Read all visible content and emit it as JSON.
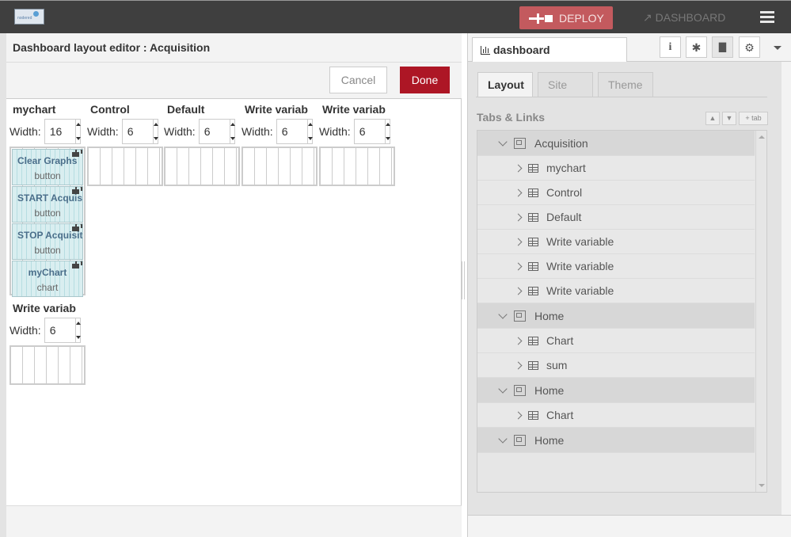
{
  "header": {
    "logo_text": "nodered",
    "deploy_label": "DEPLOY",
    "dashboard_label": "DASHBOARD"
  },
  "editor": {
    "title": "Dashboard layout editor : Acquisition",
    "cancel_label": "Cancel",
    "done_label": "Done",
    "width_label": "Width:",
    "groups": [
      {
        "name": "mychart",
        "width": "16",
        "widgets": [
          {
            "name": "Clear Graphs",
            "type": "button"
          },
          {
            "name": "START Acquisition",
            "type": "button"
          },
          {
            "name": "STOP Acquisition",
            "type": "button"
          },
          {
            "name": "myChart",
            "type": "chart"
          }
        ]
      },
      {
        "name": "Control",
        "width": "6"
      },
      {
        "name": "Default",
        "width": "6"
      },
      {
        "name": "Write variab",
        "width": "6"
      },
      {
        "name": "Write variab",
        "width": "6"
      },
      {
        "name": "Write variab",
        "width": "6"
      }
    ]
  },
  "sidebar": {
    "tab_label": "dashboard",
    "sub_tabs": [
      "Layout",
      "Site",
      "Theme"
    ],
    "section_title": "Tabs & Links",
    "mini_buttons": [
      "▲",
      "▼",
      "+ tab"
    ],
    "tree": [
      {
        "kind": "tab",
        "label": "Acquisition"
      },
      {
        "kind": "group",
        "label": "mychart"
      },
      {
        "kind": "group",
        "label": "Control"
      },
      {
        "kind": "group",
        "label": "Default"
      },
      {
        "kind": "group",
        "label": "Write variable"
      },
      {
        "kind": "group",
        "label": "Write variable"
      },
      {
        "kind": "group",
        "label": "Write variable"
      },
      {
        "kind": "tab",
        "label": "Home"
      },
      {
        "kind": "group",
        "label": "Chart"
      },
      {
        "kind": "group",
        "label": "sum"
      },
      {
        "kind": "tab",
        "label": "Home"
      },
      {
        "kind": "group",
        "label": "Chart"
      },
      {
        "kind": "tab",
        "label": "Home"
      }
    ]
  }
}
